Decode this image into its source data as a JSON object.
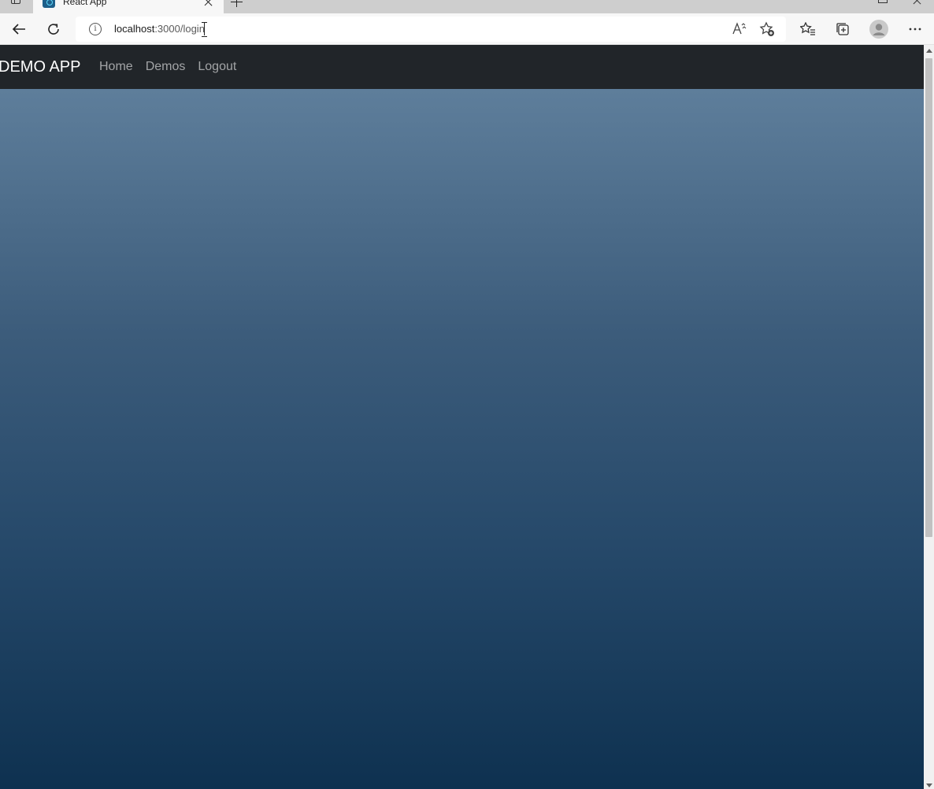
{
  "browser": {
    "tab": {
      "title": "React App",
      "favicon": "react-icon"
    },
    "address": {
      "host": "localhost",
      "rest": ":3000/login"
    },
    "icons": {
      "sidebar": "tab-actions-icon",
      "back": "back-arrow-icon",
      "refresh": "refresh-icon",
      "info": "site-info-icon",
      "read_aloud": "read-aloud-icon",
      "add_favorite": "add-favorite-icon",
      "favorites": "favorites-icon",
      "collections": "collections-icon",
      "profile": "profile-icon",
      "more": "more-icon"
    },
    "read_aloud_label": "Aᵀ"
  },
  "app": {
    "brand": "DEMO APP",
    "nav": [
      {
        "label": "Home"
      },
      {
        "label": "Demos"
      },
      {
        "label": "Logout"
      }
    ],
    "colors": {
      "navbar": "#212529",
      "gradient_top": "#5e7e9b",
      "gradient_bottom": "#0e3150"
    }
  }
}
